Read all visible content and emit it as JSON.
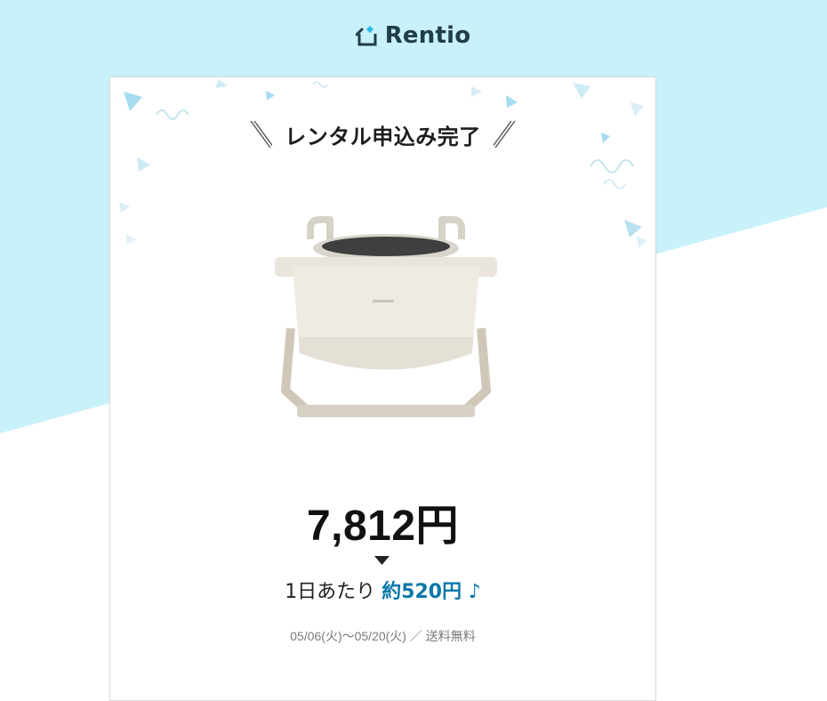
{
  "brand": {
    "name": "Rentio"
  },
  "page": {
    "heading": "レンタル申込み完了"
  },
  "product": {
    "image_alt": "electric-cooking-pot",
    "color": "#ece8df"
  },
  "pricing": {
    "total": "7,812円",
    "per_day_label": "1日あたり",
    "per_day_value": "約520円 ♪"
  },
  "rental": {
    "dates": "05/06(火)～05/20(火)",
    "separator": "／",
    "shipping": "送料無料"
  },
  "colors": {
    "background_top": "#c9f1fa",
    "accent_blue": "#0a78a8",
    "logo_dark": "#213d4d"
  }
}
